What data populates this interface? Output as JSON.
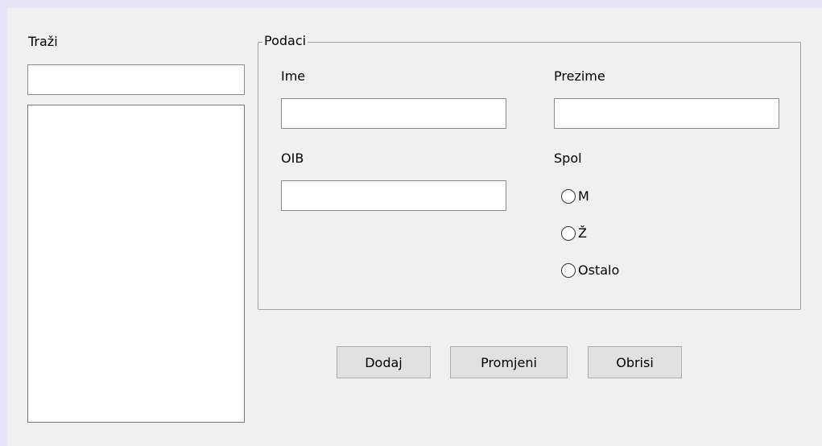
{
  "search": {
    "label": "Traži",
    "value": "",
    "list_items": []
  },
  "details": {
    "group_title": "Podaci",
    "first_name_label": "Ime",
    "first_name_value": "",
    "last_name_label": "Prezime",
    "last_name_value": "",
    "oib_label": "OIB",
    "oib_value": "",
    "gender_label": "Spol",
    "gender_options": [
      "M",
      "Ž",
      "Ostalo"
    ]
  },
  "actions": {
    "add": "Dodaj",
    "change": "Promjeni",
    "delete": "Obrisi"
  }
}
